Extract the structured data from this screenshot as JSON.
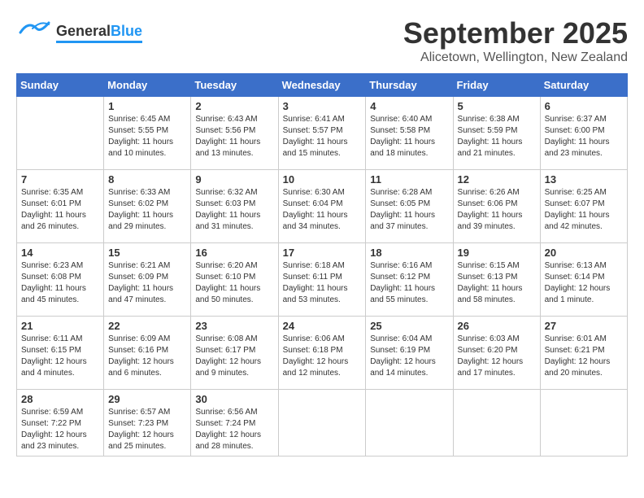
{
  "header": {
    "logo_general": "General",
    "logo_blue": "Blue",
    "month": "September 2025",
    "location": "Alicetown, Wellington, New Zealand"
  },
  "days_of_week": [
    "Sunday",
    "Monday",
    "Tuesday",
    "Wednesday",
    "Thursday",
    "Friday",
    "Saturday"
  ],
  "weeks": [
    [
      {
        "day": "",
        "info": ""
      },
      {
        "day": "1",
        "info": "Sunrise: 6:45 AM\nSunset: 5:55 PM\nDaylight: 11 hours\nand 10 minutes."
      },
      {
        "day": "2",
        "info": "Sunrise: 6:43 AM\nSunset: 5:56 PM\nDaylight: 11 hours\nand 13 minutes."
      },
      {
        "day": "3",
        "info": "Sunrise: 6:41 AM\nSunset: 5:57 PM\nDaylight: 11 hours\nand 15 minutes."
      },
      {
        "day": "4",
        "info": "Sunrise: 6:40 AM\nSunset: 5:58 PM\nDaylight: 11 hours\nand 18 minutes."
      },
      {
        "day": "5",
        "info": "Sunrise: 6:38 AM\nSunset: 5:59 PM\nDaylight: 11 hours\nand 21 minutes."
      },
      {
        "day": "6",
        "info": "Sunrise: 6:37 AM\nSunset: 6:00 PM\nDaylight: 11 hours\nand 23 minutes."
      }
    ],
    [
      {
        "day": "7",
        "info": "Sunrise: 6:35 AM\nSunset: 6:01 PM\nDaylight: 11 hours\nand 26 minutes."
      },
      {
        "day": "8",
        "info": "Sunrise: 6:33 AM\nSunset: 6:02 PM\nDaylight: 11 hours\nand 29 minutes."
      },
      {
        "day": "9",
        "info": "Sunrise: 6:32 AM\nSunset: 6:03 PM\nDaylight: 11 hours\nand 31 minutes."
      },
      {
        "day": "10",
        "info": "Sunrise: 6:30 AM\nSunset: 6:04 PM\nDaylight: 11 hours\nand 34 minutes."
      },
      {
        "day": "11",
        "info": "Sunrise: 6:28 AM\nSunset: 6:05 PM\nDaylight: 11 hours\nand 37 minutes."
      },
      {
        "day": "12",
        "info": "Sunrise: 6:26 AM\nSunset: 6:06 PM\nDaylight: 11 hours\nand 39 minutes."
      },
      {
        "day": "13",
        "info": "Sunrise: 6:25 AM\nSunset: 6:07 PM\nDaylight: 11 hours\nand 42 minutes."
      }
    ],
    [
      {
        "day": "14",
        "info": "Sunrise: 6:23 AM\nSunset: 6:08 PM\nDaylight: 11 hours\nand 45 minutes."
      },
      {
        "day": "15",
        "info": "Sunrise: 6:21 AM\nSunset: 6:09 PM\nDaylight: 11 hours\nand 47 minutes."
      },
      {
        "day": "16",
        "info": "Sunrise: 6:20 AM\nSunset: 6:10 PM\nDaylight: 11 hours\nand 50 minutes."
      },
      {
        "day": "17",
        "info": "Sunrise: 6:18 AM\nSunset: 6:11 PM\nDaylight: 11 hours\nand 53 minutes."
      },
      {
        "day": "18",
        "info": "Sunrise: 6:16 AM\nSunset: 6:12 PM\nDaylight: 11 hours\nand 55 minutes."
      },
      {
        "day": "19",
        "info": "Sunrise: 6:15 AM\nSunset: 6:13 PM\nDaylight: 11 hours\nand 58 minutes."
      },
      {
        "day": "20",
        "info": "Sunrise: 6:13 AM\nSunset: 6:14 PM\nDaylight: 12 hours\nand 1 minute."
      }
    ],
    [
      {
        "day": "21",
        "info": "Sunrise: 6:11 AM\nSunset: 6:15 PM\nDaylight: 12 hours\nand 4 minutes."
      },
      {
        "day": "22",
        "info": "Sunrise: 6:09 AM\nSunset: 6:16 PM\nDaylight: 12 hours\nand 6 minutes."
      },
      {
        "day": "23",
        "info": "Sunrise: 6:08 AM\nSunset: 6:17 PM\nDaylight: 12 hours\nand 9 minutes."
      },
      {
        "day": "24",
        "info": "Sunrise: 6:06 AM\nSunset: 6:18 PM\nDaylight: 12 hours\nand 12 minutes."
      },
      {
        "day": "25",
        "info": "Sunrise: 6:04 AM\nSunset: 6:19 PM\nDaylight: 12 hours\nand 14 minutes."
      },
      {
        "day": "26",
        "info": "Sunrise: 6:03 AM\nSunset: 6:20 PM\nDaylight: 12 hours\nand 17 minutes."
      },
      {
        "day": "27",
        "info": "Sunrise: 6:01 AM\nSunset: 6:21 PM\nDaylight: 12 hours\nand 20 minutes."
      }
    ],
    [
      {
        "day": "28",
        "info": "Sunrise: 6:59 AM\nSunset: 7:22 PM\nDaylight: 12 hours\nand 23 minutes."
      },
      {
        "day": "29",
        "info": "Sunrise: 6:57 AM\nSunset: 7:23 PM\nDaylight: 12 hours\nand 25 minutes."
      },
      {
        "day": "30",
        "info": "Sunrise: 6:56 AM\nSunset: 7:24 PM\nDaylight: 12 hours\nand 28 minutes."
      },
      {
        "day": "",
        "info": ""
      },
      {
        "day": "",
        "info": ""
      },
      {
        "day": "",
        "info": ""
      },
      {
        "day": "",
        "info": ""
      }
    ]
  ]
}
